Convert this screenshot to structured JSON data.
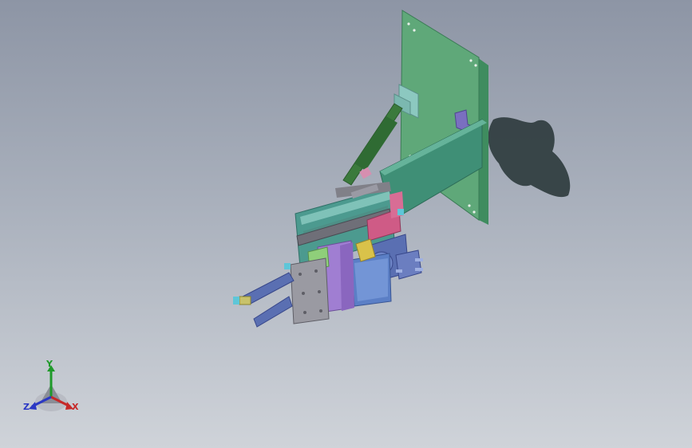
{
  "viewport": {
    "background_top": "#8d95a5",
    "background_bottom": "#cfd3d9"
  },
  "model": {
    "plate_color": "#5fa879",
    "arm_color": "#3f8f76",
    "cylinder_color": "#3b7a3c",
    "frame_color": "#4c9a8f",
    "rail_color": "#6f6f78",
    "gripper_color": "#5a6fb2",
    "accent_pink": "#cf5b86",
    "accent_purple": "#9b7bc8",
    "shadow_color": "#2c3a3c"
  },
  "triad": {
    "x_label": "X",
    "y_label": "Y",
    "z_label": "Z",
    "x_color": "#c62828",
    "y_color": "#1f9a2a",
    "z_color": "#2b38c4"
  }
}
